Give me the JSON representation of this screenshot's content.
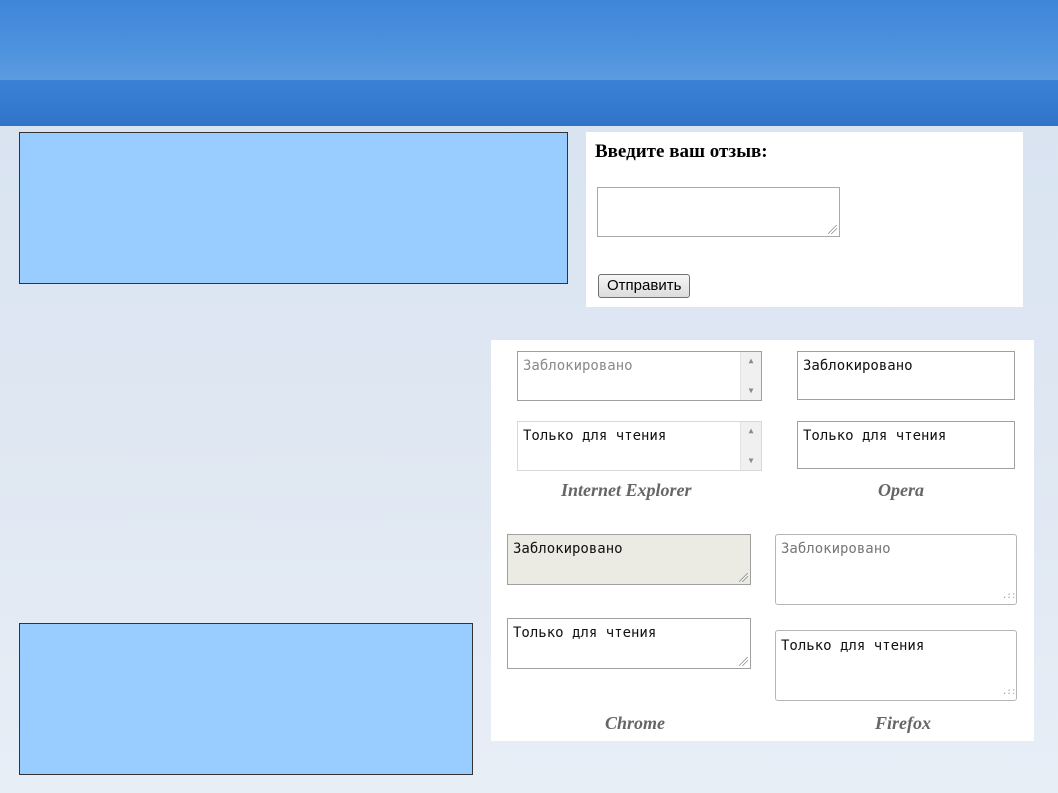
{
  "feedback_form": {
    "title": "Введите ваш отзыв:",
    "textarea_value": "",
    "submit_label": "Отправить"
  },
  "browser_examples": {
    "disabled_text": "Заблокировано",
    "readonly_text": "Только для чтения",
    "labels": {
      "ie": "Internet Explorer",
      "opera": "Opera",
      "chrome": "Chrome",
      "firefox": "Firefox"
    },
    "icons": {
      "scroll_up": "triangle-up-icon",
      "scroll_down": "triangle-down-icon",
      "resize_grip": "resize-grip-icon"
    },
    "colors": {
      "chrome_disabled_bg": "#ebebe4",
      "disabled_text": "#8a8a8a",
      "label_text": "#666666"
    }
  },
  "colors": {
    "header": "#3f86d8",
    "note_box": "#99ccff",
    "background": "#dfe7f2"
  }
}
